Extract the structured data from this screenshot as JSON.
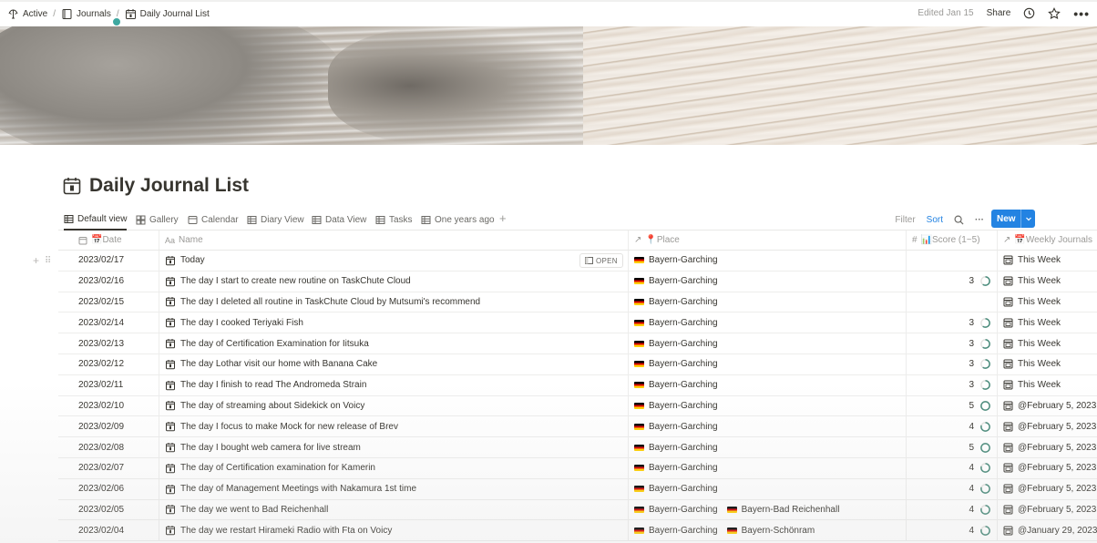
{
  "breadcrumb": {
    "items": [
      {
        "label": "Active",
        "icon": "tree-icon"
      },
      {
        "label": "Journals",
        "icon": "book-icon"
      },
      {
        "label": "Daily Journal List",
        "icon": "calendar-icon"
      }
    ],
    "separator": "/"
  },
  "topbar": {
    "edited": "Edited Jan 15",
    "share_label": "Share"
  },
  "page": {
    "title": "Daily Journal List"
  },
  "views": {
    "tabs": [
      {
        "label": "Default view",
        "icon": "table-icon",
        "active": true
      },
      {
        "label": "Gallery",
        "icon": "gallery-icon"
      },
      {
        "label": "Calendar",
        "icon": "calendar-view-icon"
      },
      {
        "label": "Diary View",
        "icon": "table-icon"
      },
      {
        "label": "Data View",
        "icon": "table-icon"
      },
      {
        "label": "Tasks",
        "icon": "table-icon"
      },
      {
        "label": "One years ago",
        "icon": "table-icon"
      }
    ],
    "add_label": "+",
    "filter_label": "Filter",
    "sort_label": "Sort",
    "more_label": "···",
    "new_label": "New"
  },
  "table": {
    "columns": {
      "date": "📅Date",
      "name": "Name",
      "name_prefix": "Aa",
      "place": "📍Place",
      "score": "📊Score (1~5)",
      "week": "📅Weekly Journals"
    },
    "open_label": "OPEN",
    "accent": "#2383e2",
    "ring_color": "#4a8c7c",
    "rows": [
      {
        "date": "2023/02/17",
        "name": "Today",
        "places": [
          "Bayern-Garching"
        ],
        "score": "",
        "week": "This Week"
      },
      {
        "date": "2023/02/16",
        "name": "The day I start to create new routine on TaskChute Cloud",
        "places": [
          "Bayern-Garching"
        ],
        "score": "3",
        "week": "This Week"
      },
      {
        "date": "2023/02/15",
        "name": "The day I deleted all routine in TaskChute Cloud by Mutsumi's recommend",
        "places": [
          "Bayern-Garching"
        ],
        "score": "",
        "week": "This Week"
      },
      {
        "date": "2023/02/14",
        "name": "The day I cooked Teriyaki Fish",
        "places": [
          "Bayern-Garching"
        ],
        "score": "3",
        "week": "This Week"
      },
      {
        "date": "2023/02/13",
        "name": "The day of Certification Examination for Iitsuka",
        "places": [
          "Bayern-Garching"
        ],
        "score": "3",
        "week": "This Week"
      },
      {
        "date": "2023/02/12",
        "name": "The day Lothar visit our home with Banana Cake",
        "places": [
          "Bayern-Garching"
        ],
        "score": "3",
        "week": "This Week"
      },
      {
        "date": "2023/02/11",
        "name": "The day I finish to read The Andromeda Strain",
        "places": [
          "Bayern-Garching"
        ],
        "score": "3",
        "week": "This Week"
      },
      {
        "date": "2023/02/10",
        "name": "The day of streaming about Sidekick on Voicy",
        "places": [
          "Bayern-Garching"
        ],
        "score": "5",
        "week": "@February 5, 2023"
      },
      {
        "date": "2023/02/09",
        "name": "The day I focus to make Mock for new release of Brev",
        "places": [
          "Bayern-Garching"
        ],
        "score": "4",
        "week": "@February 5, 2023"
      },
      {
        "date": "2023/02/08",
        "name": "The day I bought web camera for live stream",
        "places": [
          "Bayern-Garching"
        ],
        "score": "5",
        "week": "@February 5, 2023"
      },
      {
        "date": "2023/02/07",
        "name": "The day of Certification examination for Kamerin",
        "places": [
          "Bayern-Garching"
        ],
        "score": "4",
        "week": "@February 5, 2023"
      },
      {
        "date": "2023/02/06",
        "name": "The day of Management Meetings with Nakamura 1st time",
        "places": [
          "Bayern-Garching"
        ],
        "score": "4",
        "week": "@February 5, 2023"
      },
      {
        "date": "2023/02/05",
        "name": "The day we went to Bad Reichenhall",
        "places": [
          "Bayern-Garching",
          "Bayern-Bad Reichenhall"
        ],
        "score": "4",
        "week": "@February 5, 2023"
      },
      {
        "date": "2023/02/04",
        "name": "The day we restart Hirameki Radio with Fta on Voicy",
        "places": [
          "Bayern-Garching",
          "Bayern-Schönram"
        ],
        "score": "4",
        "week": "@January 29, 2023"
      }
    ]
  }
}
